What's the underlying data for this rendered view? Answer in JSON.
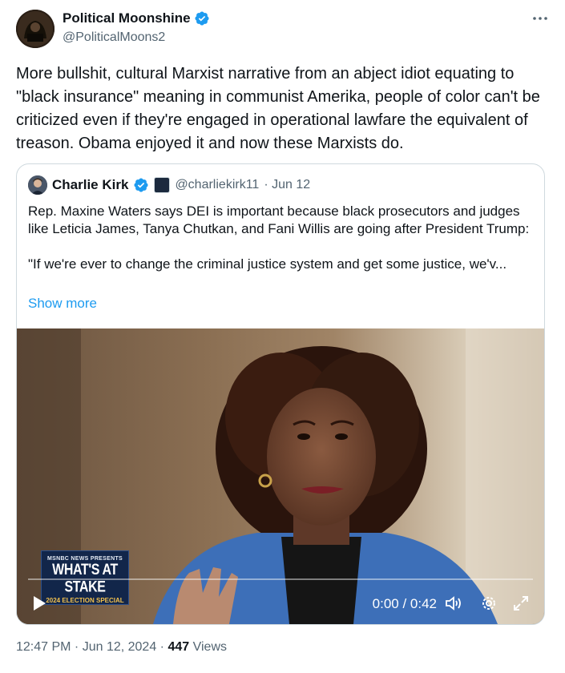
{
  "author": {
    "display_name": "Political Moonshine",
    "handle": "@PoliticalMoons2",
    "verified": true
  },
  "tweet": {
    "text": "More bullshit, cultural Marxist narrative from an abject idiot equating to \"black insurance\" meaning in communist Amerika, people of color can't be criticized even if they're engaged in operational lawfare the equivalent of treason. Obama enjoyed it and now these Marxists do."
  },
  "quoted": {
    "display_name": "Charlie Kirk",
    "handle": "@charliekirk11",
    "date": "· Jun 12",
    "paragraph_1": "Rep. Maxine Waters says DEI is important because black prosecutors and judges like Leticia James, Tanya Chutkan, and Fani Willis are going after President Trump:",
    "paragraph_2": "\"If we're ever to change the criminal justice system and get some justice, we'v...",
    "show_more": "Show more",
    "video": {
      "badge_top": "MSNBC NEWS PRESENTS",
      "badge_title": "WHAT'S AT STAKE",
      "badge_subtitle": "2024 ELECTION SPECIAL",
      "time": "0:00 / 0:42",
      "progress": 0
    }
  },
  "footer": {
    "timestamp": "12:47 PM · Jun 12, 2024 ·",
    "views_count": "447",
    "views_label": "Views"
  },
  "colors": {
    "verified": "#1d9bf0",
    "link": "#1d9bf0",
    "secondary_text": "#536471"
  }
}
